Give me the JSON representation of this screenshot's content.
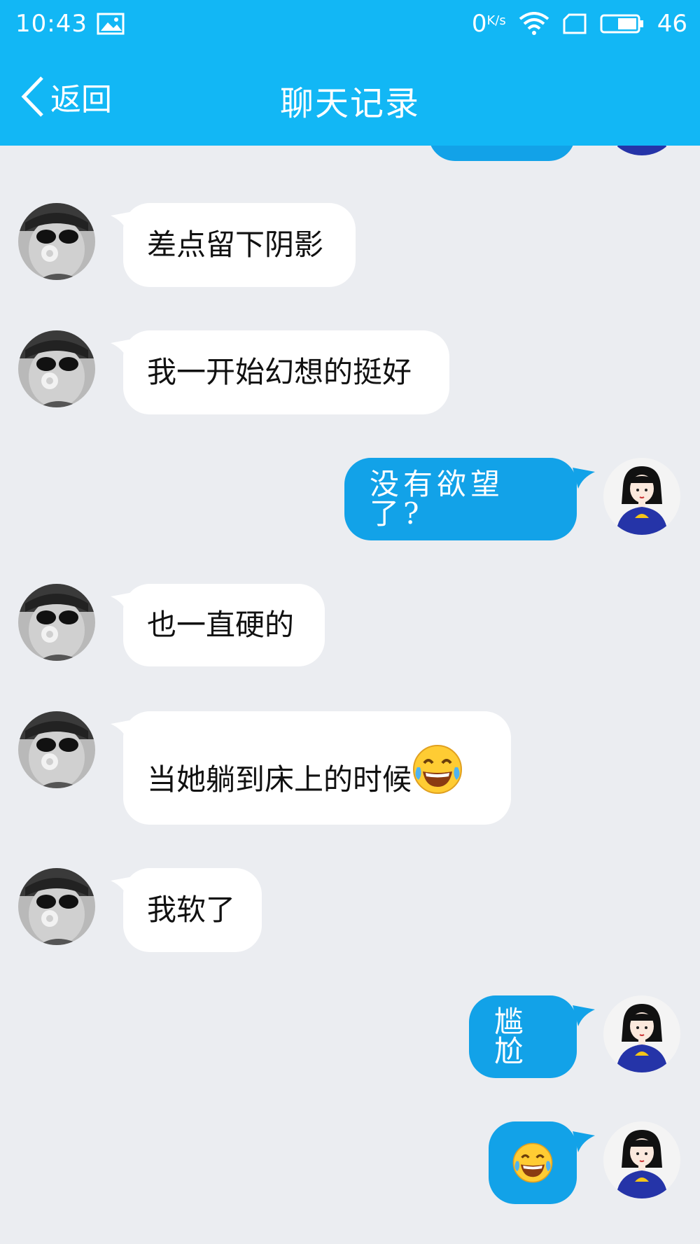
{
  "status": {
    "time": "10:43",
    "net_speed": "0",
    "net_unit": "K/s",
    "battery_label": "46"
  },
  "nav": {
    "back_label": "返回",
    "title": "聊天记录"
  },
  "messages": [
    {
      "side": "in",
      "text": "差点留下阴影"
    },
    {
      "side": "in",
      "text": "我一开始幻想的挺好"
    },
    {
      "side": "out",
      "text": "没有欲望了?"
    },
    {
      "side": "in",
      "text": "也一直硬的"
    },
    {
      "side": "in",
      "text": "当她躺到床上的时候",
      "emoji": "tears-of-joy-emoji"
    },
    {
      "side": "in",
      "text": "我软了"
    },
    {
      "side": "out",
      "text": "尴尬"
    },
    {
      "side": "out",
      "text": "",
      "emoji": "tears-of-joy-emoji"
    }
  ],
  "colors": {
    "header": "#12b7f5",
    "outgoing_bubble": "#12a2e8",
    "incoming_bubble": "#ffffff",
    "background": "#ebedf1"
  }
}
